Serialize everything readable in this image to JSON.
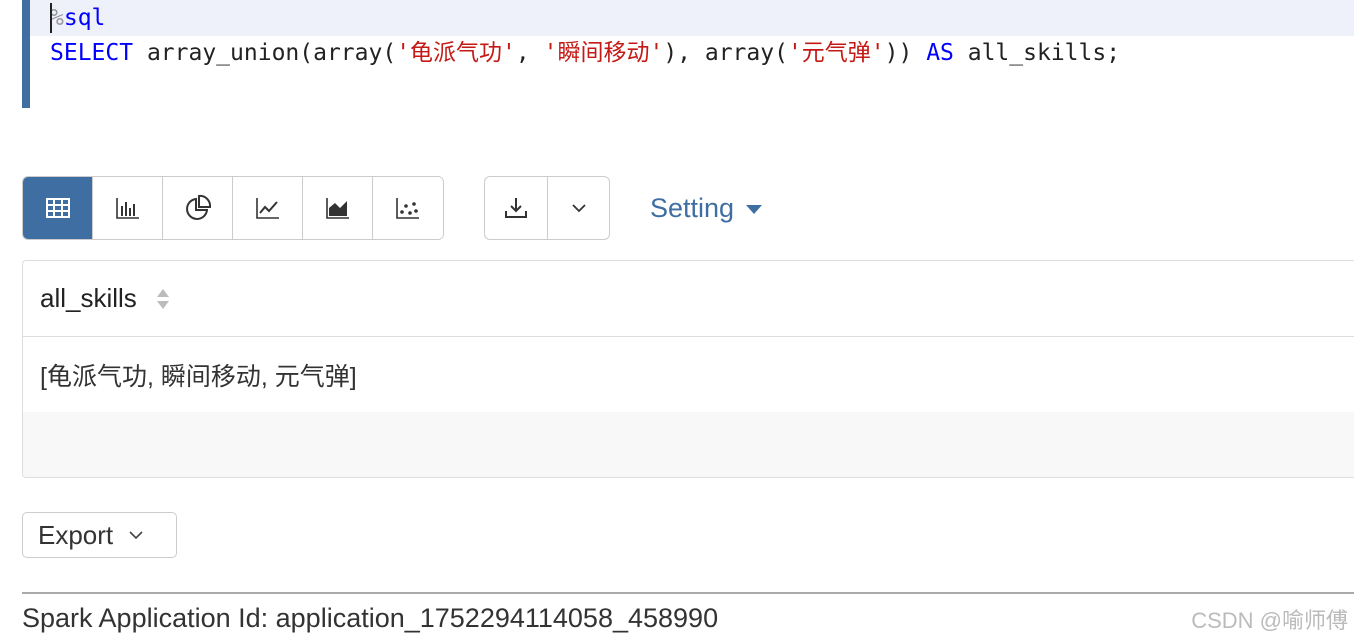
{
  "editor": {
    "magic_prefix": "%",
    "magic_cmd": "sql",
    "code": {
      "kw_select": "SELECT",
      "fn_open": " array_union(array(",
      "str1": "'龟派气功'",
      "sep1": ", ",
      "str2": "'瞬间移动'",
      "mid": "), array(",
      "str3": "'元气弹'",
      "close": ")) ",
      "kw_as": "AS",
      "alias": " all_skills;"
    }
  },
  "viz_toolbar": {
    "buttons": [
      {
        "icon": "table-icon",
        "active": true
      },
      {
        "icon": "bar-chart-icon",
        "active": false
      },
      {
        "icon": "pie-chart-icon",
        "active": false
      },
      {
        "icon": "line-chart-icon",
        "active": false
      },
      {
        "icon": "area-chart-icon",
        "active": false
      },
      {
        "icon": "scatter-chart-icon",
        "active": false
      }
    ],
    "download_icon": "download-icon",
    "dropdown_icon": "chevron-down-icon",
    "setting_label": "Setting"
  },
  "colors": {
    "accent": "#3f6ea3",
    "keyword": "#0000ff",
    "string": "#c41a16"
  },
  "result_table": {
    "columns": [
      "all_skills"
    ],
    "rows": [
      [
        "[龟派气功, 瞬间移动, 元气弹]"
      ]
    ]
  },
  "export": {
    "label": "Export"
  },
  "footer": {
    "app_id": "Spark Application Id: application_1752294114058_458990",
    "watermark": "CSDN @喻师傅"
  }
}
